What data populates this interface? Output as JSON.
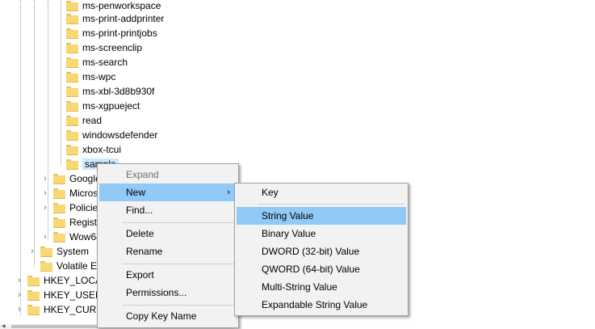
{
  "tree": {
    "items": [
      {
        "label": "ms-penworkspace"
      },
      {
        "label": "ms-print-addprinter"
      },
      {
        "label": "ms-print-printjobs"
      },
      {
        "label": "ms-screenclip"
      },
      {
        "label": "ms-search"
      },
      {
        "label": "ms-wpc"
      },
      {
        "label": "ms-xbl-3d8b930f"
      },
      {
        "label": "ms-xgpueject"
      },
      {
        "label": "read"
      },
      {
        "label": "windowsdefender"
      },
      {
        "label": "xbox-tcui"
      },
      {
        "label": "sample"
      },
      {
        "label": "Google"
      },
      {
        "label": "Microsoft"
      },
      {
        "label": "Policies"
      },
      {
        "label": "RegisteredApplications"
      },
      {
        "label": "Wow6432Node"
      },
      {
        "label": "System"
      },
      {
        "label": "Volatile Environment"
      },
      {
        "label": "HKEY_LOCAL_MACHINE"
      },
      {
        "label": "HKEY_USERS"
      },
      {
        "label": "HKEY_CURRENT_CONFIG"
      }
    ]
  },
  "context_menu": {
    "expand": "Expand",
    "new": "New",
    "find": "Find...",
    "delete": "Delete",
    "rename": "Rename",
    "export": "Export",
    "permissions": "Permissions...",
    "copy_key_name": "Copy Key Name"
  },
  "submenu": {
    "key": "Key",
    "string_value": "String Value",
    "binary_value": "Binary Value",
    "dword_value": "DWORD (32-bit) Value",
    "qword_value": "QWORD (64-bit) Value",
    "multi_string_value": "Multi-String Value",
    "expandable_string_value": "Expandable String Value"
  },
  "icons": {
    "folder": "folder-icon",
    "expander": "chevron-right-icon",
    "submenu_arrow": "chevron-right-icon"
  },
  "colors": {
    "folder": "#f8d775",
    "selection": "#cce8ff",
    "menu_highlight": "#91c9f7",
    "menu_bg": "#f2f2f2"
  }
}
